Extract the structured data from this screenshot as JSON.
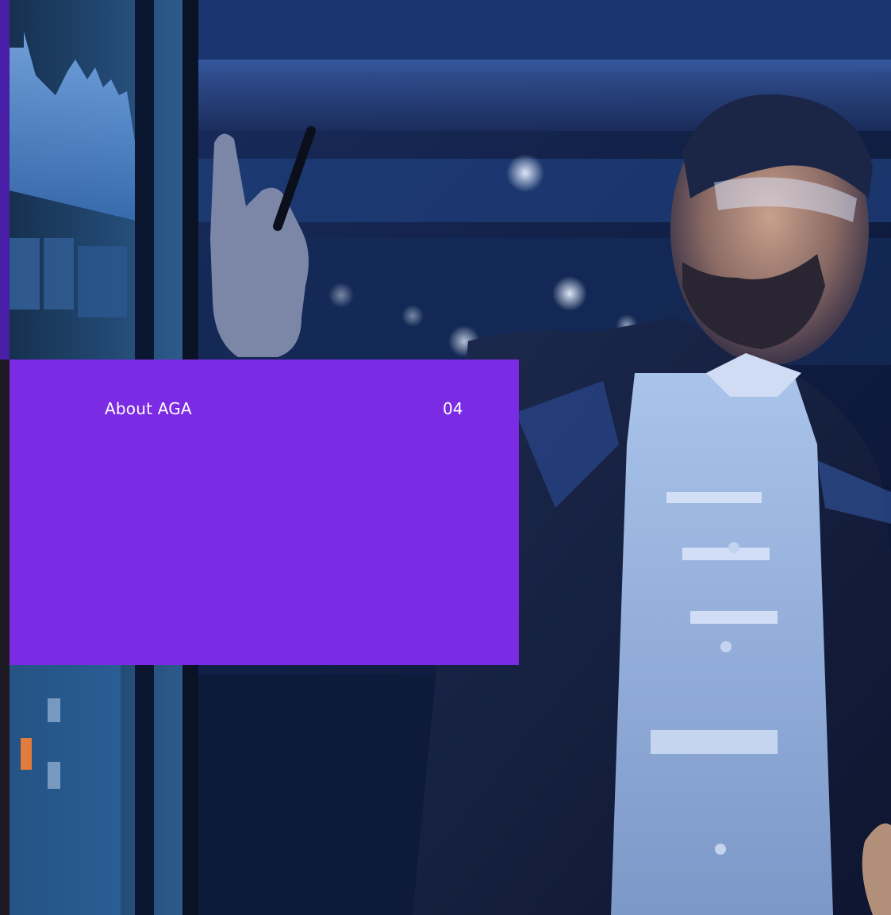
{
  "section": {
    "title": "About AGA",
    "page_number": "04"
  },
  "photo": {
    "description_icon": "presenter-photo",
    "colors": {
      "accent_card": "#7a2be3",
      "edge_strip": "#4a1fa8",
      "scene_dark": "#0a0f1e",
      "scene_blue": "#2a4fa0"
    }
  }
}
